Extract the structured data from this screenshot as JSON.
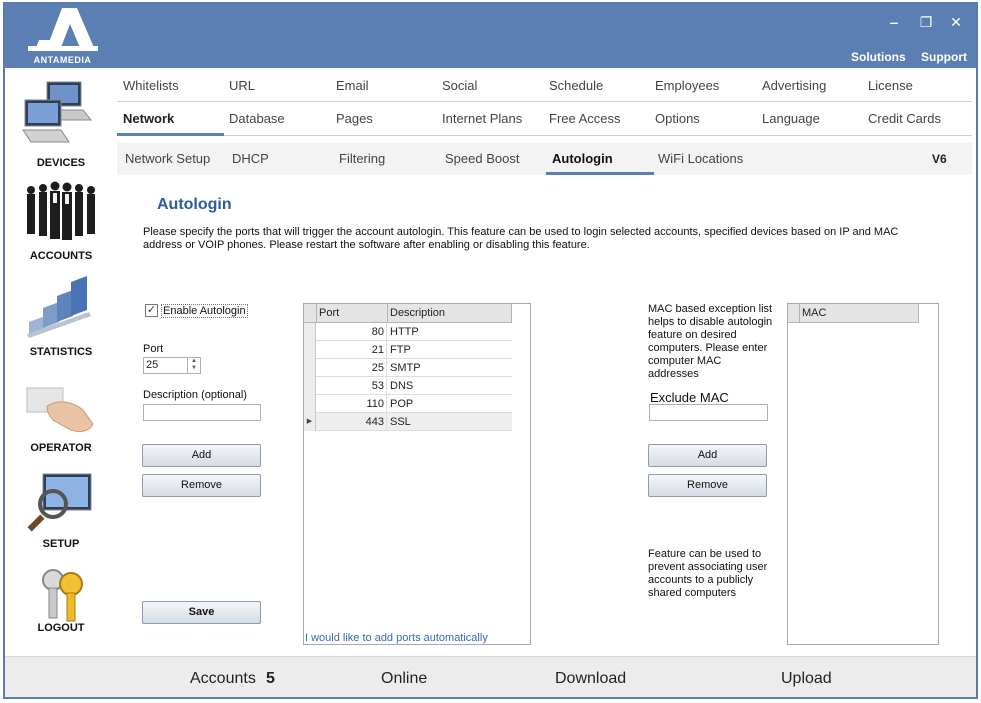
{
  "window": {
    "brand": "ANTAMEDIA",
    "controls": {
      "minimize": "‒",
      "restore": "❐",
      "close": "✕"
    },
    "links": {
      "solutions": "Solutions",
      "support": "Support"
    }
  },
  "sidebar": {
    "items": [
      {
        "label": "DEVICES",
        "icon": "computers-icon"
      },
      {
        "label": "ACCOUNTS",
        "icon": "people-icon"
      },
      {
        "label": "STATISTICS",
        "icon": "bar-chart-icon"
      },
      {
        "label": "OPERATOR",
        "icon": "hand-card-icon"
      },
      {
        "label": "SETUP",
        "icon": "magnifier-monitor-icon"
      },
      {
        "label": "LOGOUT",
        "icon": "keys-icon"
      }
    ]
  },
  "tabs": {
    "row1": [
      "Whitelists",
      "URL",
      "Email",
      "Social",
      "Schedule",
      "Employees",
      "Advertising",
      "License"
    ],
    "row2": [
      "Network",
      "Database",
      "Pages",
      "Internet Plans",
      "Free Access",
      "Options",
      "Language",
      "Credit Cards"
    ],
    "row3": [
      "Network Setup",
      "DHCP",
      "Filtering",
      "Speed Boost",
      "Autologin",
      "WiFi Locations"
    ],
    "version": "V6",
    "active_row2": "Network",
    "active_row3": "Autologin"
  },
  "page": {
    "title": "Autologin",
    "description": "Please specify the ports that will trigger the account autologin. This feature can be used to login selected accounts, specified devices based on IP and MAC address or VOIP phones. Please restart the software after enabling or disabling this feature."
  },
  "left_panel": {
    "enable_label": "Enable Autologin",
    "enable_checked": true,
    "port_label": "Port",
    "port_value": "25",
    "description_label": "Description (optional)",
    "description_value": "",
    "add_label": "Add",
    "remove_label": "Remove",
    "save_label": "Save"
  },
  "ports_grid": {
    "columns": [
      "Port",
      "Description"
    ],
    "rows": [
      {
        "port": "80",
        "description": "HTTP"
      },
      {
        "port": "21",
        "description": "FTP"
      },
      {
        "port": "25",
        "description": "SMTP"
      },
      {
        "port": "53",
        "description": "DNS"
      },
      {
        "port": "110",
        "description": "POP"
      },
      {
        "port": "443",
        "description": "SSL"
      }
    ],
    "current_row_marker": "▶",
    "auto_link": "I would like to add ports automatically"
  },
  "mac_panel": {
    "info": "MAC based exception list helps to disable autologin feature on desired computers. Please enter computer MAC addresses",
    "exclude_label": "Exclude MAC",
    "exclude_value": "",
    "add_label": "Add",
    "remove_label": "Remove",
    "note": "Feature can be used to prevent associating user accounts to a publicly shared computers",
    "grid_column": "MAC"
  },
  "footer": {
    "accounts_label": "Accounts",
    "accounts_value": "5",
    "online_label": "Online",
    "download_label": "Download",
    "upload_label": "Upload"
  },
  "colors": {
    "titlebar": "#5b7fb2",
    "title_text": "#2d5d9a",
    "active_tab_underline": "#5b7fb2"
  }
}
